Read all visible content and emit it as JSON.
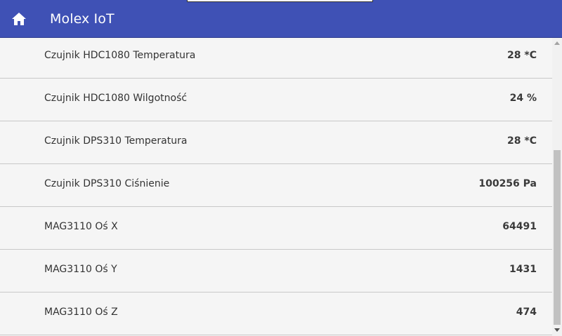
{
  "header": {
    "title": "Molex IoT",
    "home_icon": "home-icon",
    "background": "#3f51b5"
  },
  "sensors": [
    {
      "label": "Czujnik HDC1080 Temperatura",
      "value": "28 *C"
    },
    {
      "label": "Czujnik HDC1080 Wilgotność",
      "value": "24 %"
    },
    {
      "label": "Czujnik DPS310 Temperatura",
      "value": "28 *C"
    },
    {
      "label": "Czujnik DPS310 Ciśnienie",
      "value": "100256 Pa"
    },
    {
      "label": "MAG3110 Oś X",
      "value": "64491"
    },
    {
      "label": "MAG3110 Oś Y",
      "value": "1431"
    },
    {
      "label": "MAG3110 Oś Z",
      "value": "474"
    }
  ]
}
